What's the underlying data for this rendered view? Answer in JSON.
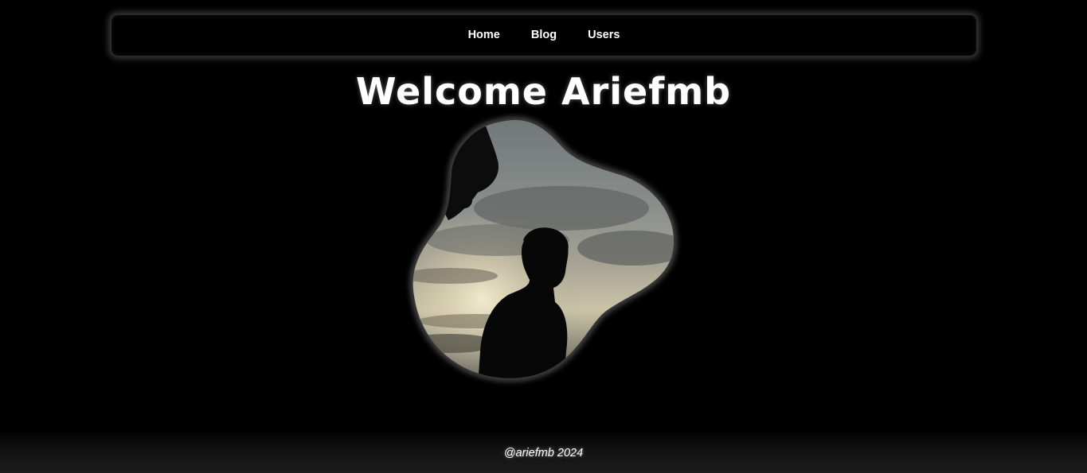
{
  "nav": {
    "items": [
      {
        "label": "Home"
      },
      {
        "label": "Blog"
      },
      {
        "label": "Users"
      }
    ]
  },
  "hero": {
    "title": "Welcome Ariefmb",
    "image_icon": "profile-silhouette-image"
  },
  "footer": {
    "text": "@ariefmb 2024"
  },
  "colors": {
    "background": "#000000",
    "text": "#ffffff",
    "nav_border": "#2a2a2a"
  }
}
